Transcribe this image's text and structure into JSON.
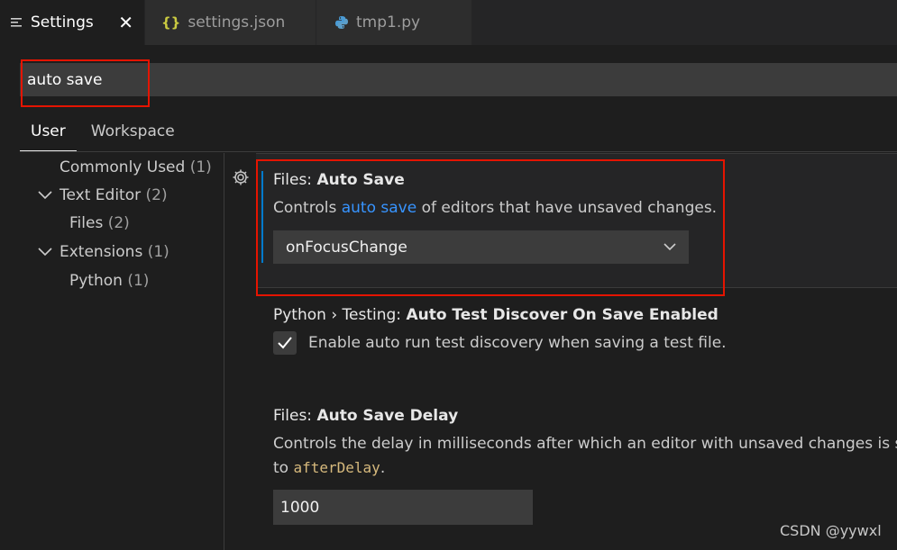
{
  "tabs": [
    {
      "label": "Settings",
      "icon": "settings-list-icon",
      "active": true
    },
    {
      "label": "settings.json",
      "icon": "json-braces-icon",
      "active": false
    },
    {
      "label": "tmp1.py",
      "icon": "python-icon",
      "active": false
    }
  ],
  "search": {
    "value": "auto save"
  },
  "scope_tabs": [
    "User",
    "Workspace"
  ],
  "toc": [
    {
      "label": "Commonly Used",
      "count": "(1)"
    },
    {
      "label": "Text Editor",
      "count": "(2)"
    },
    {
      "label": "Files",
      "count": "(2)"
    },
    {
      "label": "Extensions",
      "count": "(1)"
    },
    {
      "label": "Python",
      "count": "(1)"
    }
  ],
  "settings": {
    "auto_save": {
      "category": "Files: ",
      "key": "Auto Save",
      "desc_pre": "Controls ",
      "desc_link": "auto save",
      "desc_post": " of editors that have unsaved changes.",
      "value": "onFocusChange"
    },
    "python_testing": {
      "category": "Python › Testing: ",
      "key": "Auto Test Discover On Save Enabled",
      "checkbox_label": "Enable auto run test discovery when saving a test file.",
      "checked": true
    },
    "auto_save_delay": {
      "category": "Files: ",
      "key": "Auto Save Delay",
      "desc_line1": "Controls the delay in milliseconds after which an editor with unsaved changes is saved automatically. Only applies when",
      "desc_line2_pre": "to ",
      "desc_line2_code": "afterDelay",
      "desc_line2_post": ".",
      "value": "1000"
    }
  },
  "watermark": "CSDN @yywxl",
  "colors": {
    "accent": "#007acc",
    "link": "#3794ff",
    "highlight_box": "#e51400"
  }
}
